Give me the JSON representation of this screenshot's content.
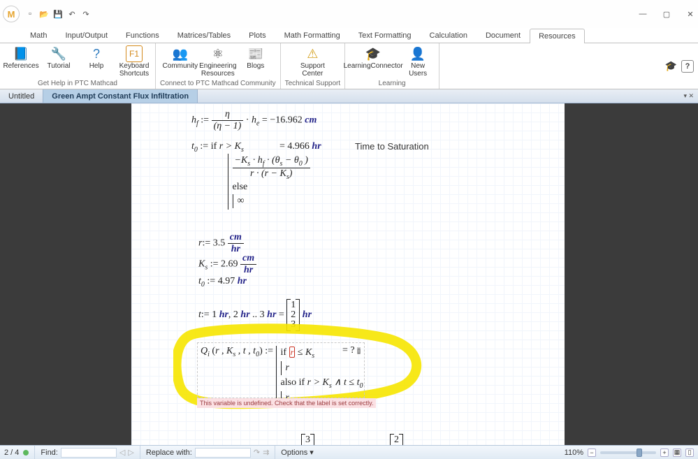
{
  "app": {
    "logo": "M"
  },
  "qat": {
    "new": "new",
    "open": "open",
    "save": "save",
    "undo": "undo",
    "redo": "redo"
  },
  "win": {
    "min": "—",
    "max": "▢",
    "close": "✕"
  },
  "tabs": [
    "Math",
    "Input/Output",
    "Functions",
    "Matrices/Tables",
    "Plots",
    "Math Formatting",
    "Text Formatting",
    "Calculation",
    "Document",
    "Resources"
  ],
  "tabs_active": 9,
  "ribbon": {
    "group1": {
      "items": [
        {
          "label": "References"
        },
        {
          "label": "Tutorial"
        },
        {
          "label": "Help"
        },
        {
          "label": "Keyboard Shortcuts"
        }
      ],
      "caption": "Get Help in PTC Mathcad"
    },
    "group2": {
      "items": [
        {
          "label": "Community"
        },
        {
          "label": "Engineering Resources"
        },
        {
          "label": "Blogs"
        }
      ],
      "caption": "Connect to PTC Mathcad Community"
    },
    "group3": {
      "items": [
        {
          "label": "Support Center"
        }
      ],
      "caption": "Technical Support"
    },
    "group4": {
      "items": [
        {
          "label": "LearningConnector"
        },
        {
          "label": "New Users"
        }
      ],
      "caption": "Learning"
    },
    "help": "?"
  },
  "doctabs": [
    {
      "label": "Untitled",
      "active": false
    },
    {
      "label": "Green Ampt Constant Flux Infiltration",
      "active": true
    }
  ],
  "content": {
    "hf_lhs": "h",
    "hf_sub": "f",
    "he_val": "−16.962",
    "he_unit": "cm",
    "he_sym": "h",
    "he_sub": "e",
    "eta": "η",
    "etam1": "(η − 1)",
    "t0_lhs": "t",
    "t0_sub": "0",
    "if_kw": "if",
    "else_kw": "else",
    "gt_cond": "r > K",
    "inf": "∞",
    "t0_num": "−K",
    "t0_num2": "· h",
    "t0_num3": "· (θ",
    "t0_num4": " − θ",
    "t0_num5": ")",
    "t0_den": "r · (r − K",
    "t0_den2": ")",
    "t0_result": "= 4.966",
    "t0_result_unit": "hr",
    "sat_label": "Time to Saturation",
    "r_lhs": "r",
    "r_val": "3.5",
    "r_unit_n": "cm",
    "r_unit_d": "hr",
    "ks_lhs": "K",
    "ks_sub": "s",
    "ks_val": "2.69",
    "t0v_val": "4.97",
    "t0v_unit": "hr",
    "t_lhs": "t",
    "t_rng": "1",
    "t_rng2": "2",
    "t_rng3": "3",
    "t_runit": "hr",
    "t_matrix": [
      "1",
      "2",
      "3"
    ],
    "qi_lhs": "Q",
    "qi_sub": "i",
    "qi_args": "(r , K",
    "qi_args2": " , t , t",
    "qi_args3": ")",
    "qi_if": "if",
    "qi_cond_var": "r",
    "qi_cond": "≤ K",
    "qi_body": "r",
    "qi_also": "also if",
    "qi_cond2": "r > K",
    "qi_cond2b": "∧ t ≤ t",
    "qi_result": "= ?",
    "errmsg": "This variable is undefined. Check that the label is set correctly.",
    "bottom_m1": "3",
    "bottom_m2": "2",
    "assign": ":="
  },
  "status": {
    "page": "2 / 4",
    "find_label": "Find:",
    "find_val": "",
    "replace_label": "Replace with:",
    "replace_val": "",
    "options": "Options",
    "zoom": "110%"
  }
}
